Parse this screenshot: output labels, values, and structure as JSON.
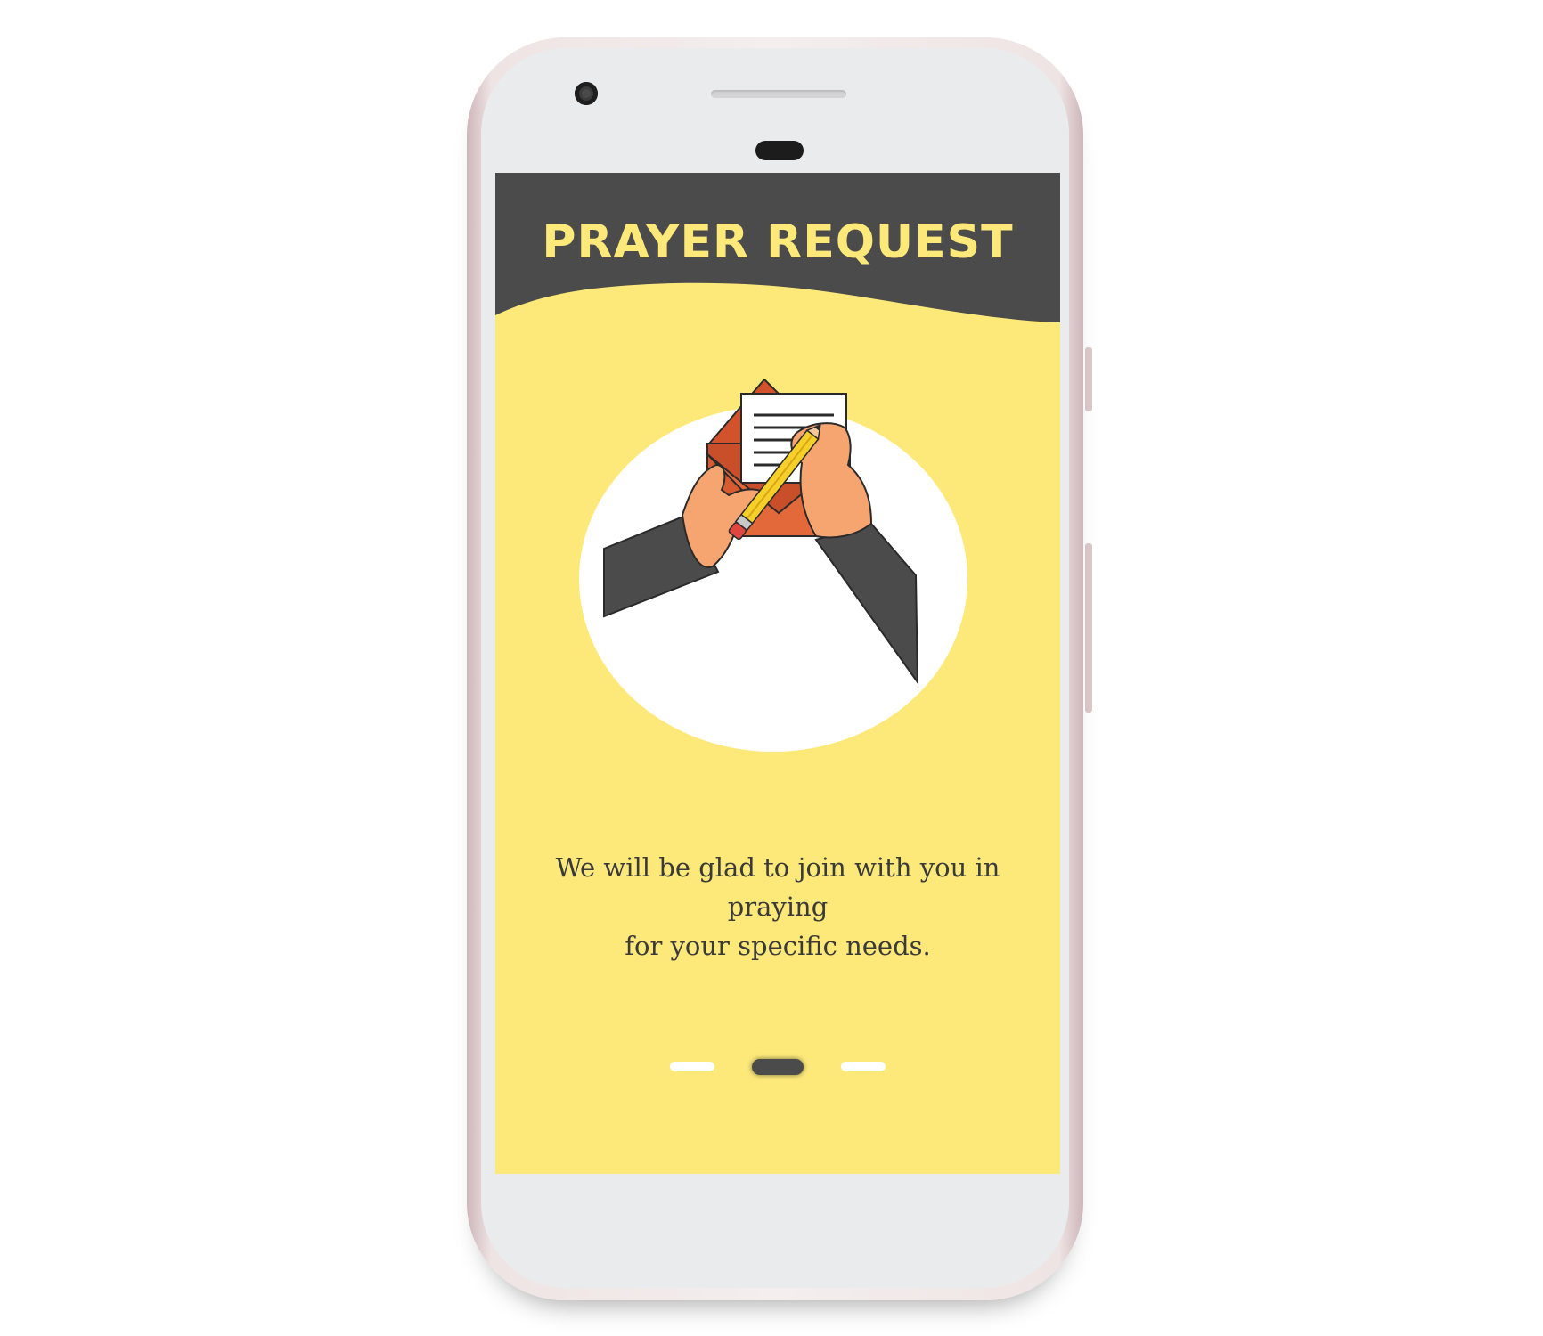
{
  "screen": {
    "title": "PRAYER REQUEST",
    "message_line1": "We will be glad to join with you in praying",
    "message_line2": "for your specific needs.",
    "illustration_icon": "letter-writing-icon",
    "pager": {
      "pages": 3,
      "active_index": 1
    }
  },
  "colors": {
    "background": "#fde97a",
    "header": "#4b4b4b",
    "title": "#fde97a",
    "envelope": "#e06a35",
    "skin": "#f6a470",
    "sleeve": "#4b4b4b"
  }
}
